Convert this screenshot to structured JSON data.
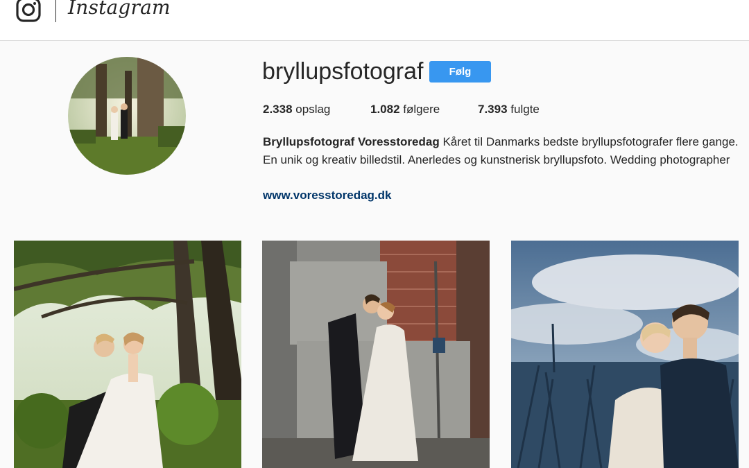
{
  "header": {
    "logo_text": "Instagram",
    "camera_icon": "instagram-camera-icon"
  },
  "profile": {
    "username": "bryllupsfotograf",
    "follow_label": "Følg",
    "stats": [
      {
        "count": "2.338",
        "label": "opslag"
      },
      {
        "count": "1.082",
        "label": "følgere"
      },
      {
        "count": "7.393",
        "label": "fulgte"
      }
    ],
    "bio_name": "Bryllupsfotograf Voresstoredag",
    "bio_text": " Kåret til Danmarks bedste bryllupsfotografer flere gange. En unik og kreativ billedstil. Anerledes og kunstnerisk bryllupsfoto. Wedding photographer",
    "website": "www.voresstoredag.dk"
  },
  "posts": [
    {
      "subject": "bride-and-groom-under-tree"
    },
    {
      "subject": "couple-kissing-by-concrete-wall"
    },
    {
      "subject": "couple-in-tall-grass-under-sky"
    }
  ],
  "colors": {
    "follow_button": "#3897f0",
    "link": "#003569",
    "background": "#fafafa"
  }
}
